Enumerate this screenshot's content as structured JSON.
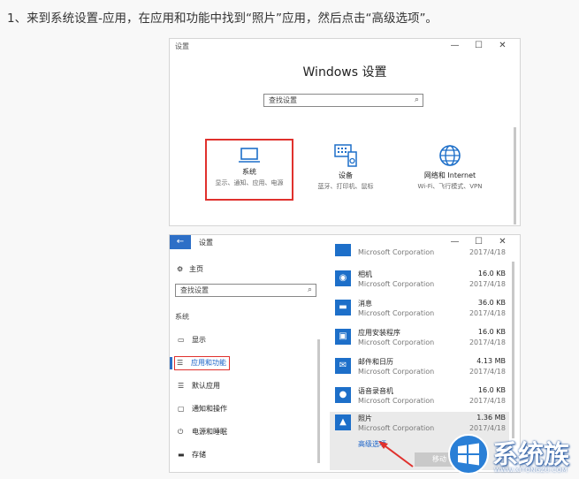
{
  "instruction": "1、来到系统设置-应用，在应用和功能中找到“照片”应用，然后点击“高级选项”。",
  "window1": {
    "title": "设置",
    "caption": [
      "—",
      "☐",
      "✕"
    ],
    "heading": "Windows 设置",
    "search_placeholder": "查找设置",
    "tiles": [
      {
        "icon": "laptop-icon",
        "title": "系统",
        "desc": "显示、通知、应用、电源"
      },
      {
        "icon": "devices-icon",
        "title": "设备",
        "desc": "蓝牙、打印机、鼠标"
      },
      {
        "icon": "globe-icon",
        "title": "网络和 Internet",
        "desc": "Wi-Fi、飞行模式、VPN"
      }
    ]
  },
  "window2": {
    "title": "设置",
    "caption": [
      "—",
      "☐",
      "✕"
    ],
    "home": "主页",
    "search_placeholder": "查找设置",
    "section": "系统",
    "nav": [
      {
        "icon": "display-icon",
        "label": "显示"
      },
      {
        "icon": "apps-list-icon",
        "label": "应用和功能",
        "active": true
      },
      {
        "icon": "default-apps-icon",
        "label": "默认应用"
      },
      {
        "icon": "notifications-icon",
        "label": "通知和操作"
      },
      {
        "icon": "power-icon",
        "label": "电源和睡眠"
      },
      {
        "icon": "storage-icon",
        "label": "存储"
      }
    ],
    "apps": [
      {
        "name": "",
        "publisher": "Microsoft Corporation",
        "size": "",
        "date": "2017/4/18"
      },
      {
        "name": "相机",
        "publisher": "Microsoft Corporation",
        "size": "16.0 KB",
        "date": "2017/4/18"
      },
      {
        "name": "消息",
        "publisher": "Microsoft Corporation",
        "size": "36.0 KB",
        "date": "2017/4/18"
      },
      {
        "name": "应用安装程序",
        "publisher": "Microsoft Corporation",
        "size": "16.0 KB",
        "date": "2017/4/18"
      },
      {
        "name": "邮件和日历",
        "publisher": "Microsoft Corporation",
        "size": "4.13 MB",
        "date": "2017/4/18"
      },
      {
        "name": "语音录音机",
        "publisher": "Microsoft Corporation",
        "size": "16.0 KB",
        "date": "2017/4/18"
      },
      {
        "name": "照片",
        "publisher": "Microsoft Corporation",
        "size": "1.36 MB",
        "date": "2017/4/18"
      }
    ],
    "advanced_link": "高级选项",
    "move_button": "移动"
  },
  "watermark": {
    "brand": "系统族",
    "url": "WWW.XITONGZU.COM"
  },
  "colors": {
    "accent": "#1d6fc9",
    "highlight_box": "#e0312d",
    "link": "#1a63c8"
  }
}
